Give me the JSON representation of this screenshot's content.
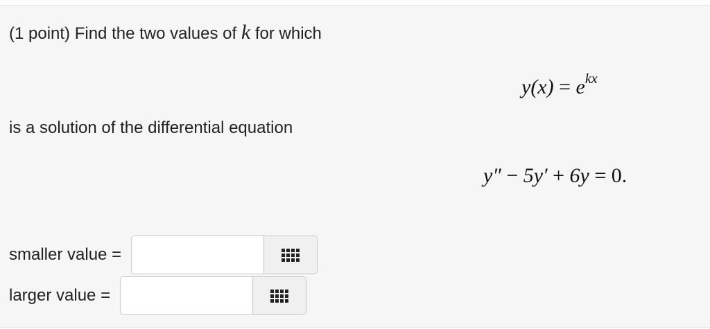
{
  "problem": {
    "intro_before_k": "(1 point) Find the two values of",
    "k_symbol": "k",
    "intro_after_k": "for which",
    "equation1": {
      "lhs": "y(x)",
      "equals": "=",
      "base": "e",
      "exponent": "kx"
    },
    "middle_text": "is a solution of the differential equation",
    "equation2": {
      "term1": "y″",
      "op1": "−",
      "term2": "5y′",
      "op2": "+",
      "term3": "6y",
      "equals": "=",
      "rhs": "0."
    }
  },
  "answers": [
    {
      "label": "smaller value =",
      "value": "",
      "palette_icon": "grid-icon"
    },
    {
      "label": "larger value =",
      "value": "",
      "palette_icon": "grid-icon"
    }
  ]
}
